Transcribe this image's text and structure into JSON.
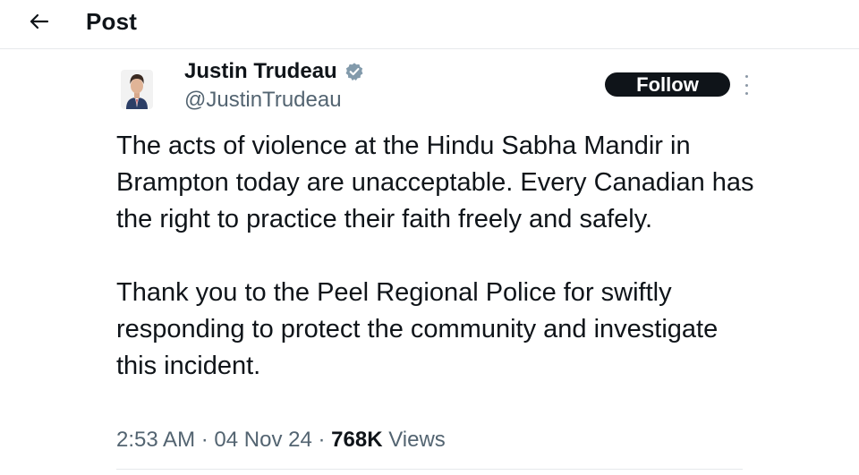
{
  "header": {
    "title": "Post",
    "back_icon": "arrow-left-icon"
  },
  "author": {
    "name": "Justin Trudeau",
    "handle": "@JustinTrudeau",
    "verified_icon": "verified-badge-icon",
    "verified_color": "#829aab"
  },
  "follow": {
    "label": "Follow",
    "bg_color": "#0f1419",
    "text_color": "#ffffff"
  },
  "more_icon": "more-vertical-icon",
  "tweet": {
    "paragraphs": [
      "The acts of violence at the Hindu Sabha Mandir in Brampton today are unacceptable. Every Canadian has the right to practice their faith freely and safely.",
      "Thank you to the Peel Regional Police for swiftly responding to protect the community and investigate this incident."
    ]
  },
  "meta": {
    "time": "2:53 AM",
    "date": "04 Nov 24",
    "separator": "·",
    "views_count": "768K",
    "views_label": "Views"
  }
}
